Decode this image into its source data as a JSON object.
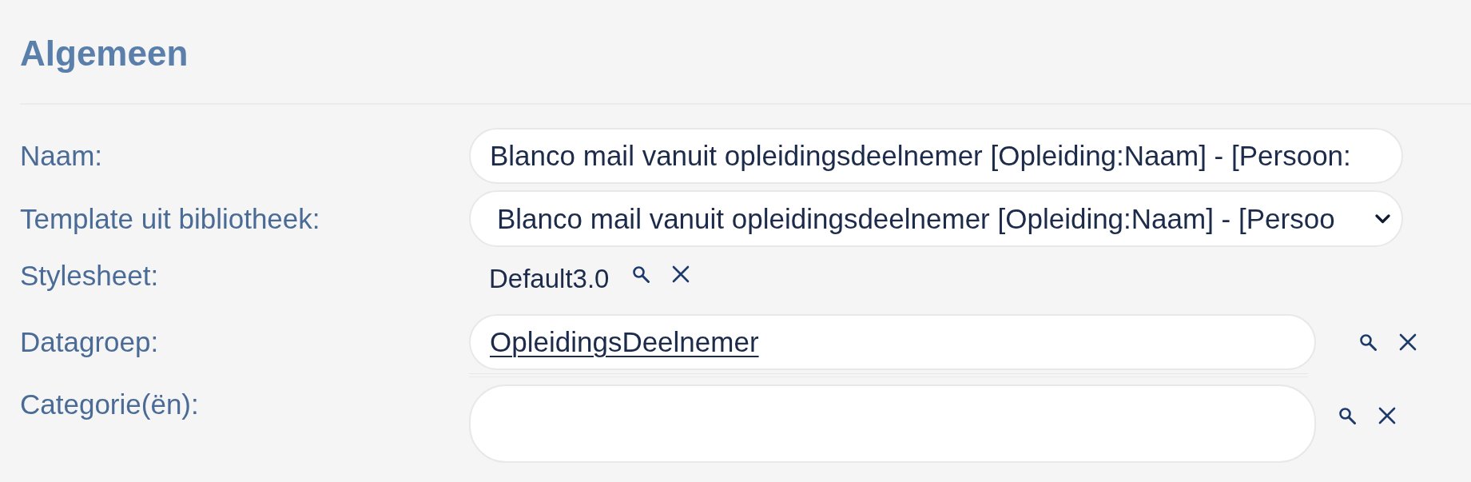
{
  "section": {
    "title": "Algemeen"
  },
  "fields": [
    {
      "kind": "text",
      "label": "Naam:",
      "value": "Blanco mail vanuit opleidingsdeelnemer [Opleiding:Naam] - [Persoon:"
    },
    {
      "kind": "select",
      "label": "Template uit bibliotheek:",
      "value": "Blanco mail vanuit opleidingsdeelnemer [Opleiding:Naam] - [Persoo"
    },
    {
      "kind": "lookup",
      "label": "Stylesheet:",
      "value": "Default3.0"
    },
    {
      "kind": "link-lookup",
      "label": "Datagroep:",
      "value": "OpleidingsDeelnemer"
    },
    {
      "kind": "area-lookup",
      "label": "Categorie(ën):"
    }
  ]
}
